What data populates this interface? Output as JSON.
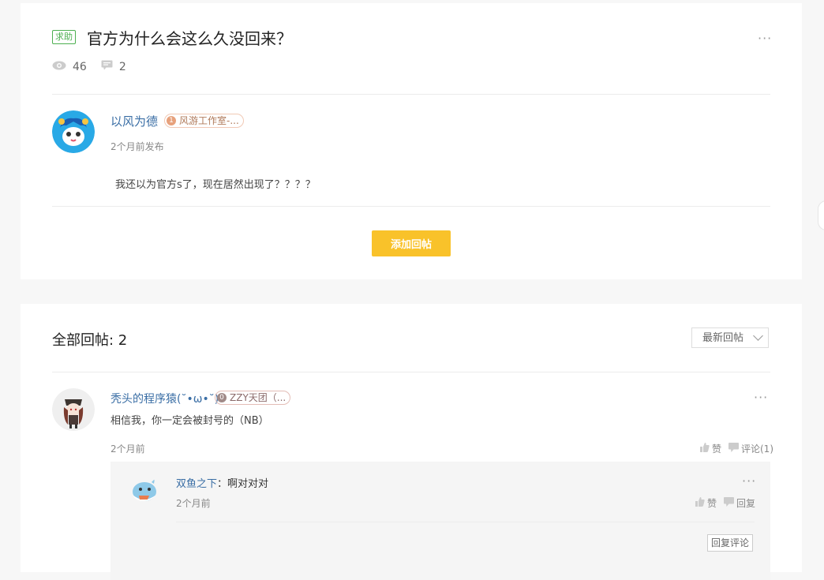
{
  "post": {
    "tag": "求助",
    "title": "官方为什么会这么久没回来？",
    "views": "46",
    "comments": "2",
    "author": {
      "name": "以风为德",
      "badge_level": "1",
      "badge_text": "风游工作室-...",
      "time": "2个月前发布"
    },
    "body": "我还以为官方s了，现在居然出现了？？？？",
    "add_reply_label": "添加回帖"
  },
  "replies": {
    "title": "全部回帖: 2",
    "sort_label": "最新回帖",
    "items": [
      {
        "name": "秃头的程序猿(˘•ω•˘)",
        "badge_level": "0",
        "badge_text": "ZZY天团（...",
        "text": "相信我，你一定会被封号的（NB）",
        "time": "2个月前",
        "like_label": "赞",
        "comment_label": "评论(1)",
        "sub": {
          "name": "双鱼之下",
          "separator": "：",
          "text": "啊对对对",
          "time": "2个月前",
          "like_label": "赞",
          "reply_label": "回复",
          "reply_comment_label": "回复评论"
        }
      }
    ]
  },
  "colors": {
    "accent_yellow": "#f9c22a",
    "link_blue": "#3a6ea5",
    "tag_green": "#4caf50"
  }
}
